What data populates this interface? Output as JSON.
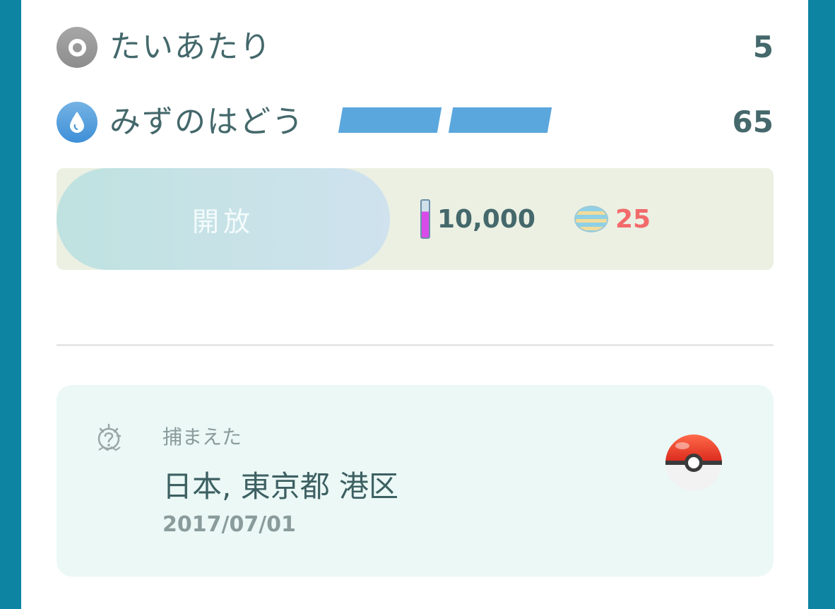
{
  "moves": [
    {
      "type_icon": "normal-type-icon",
      "name": "たいあたり",
      "power": "5"
    },
    {
      "type_icon": "water-type-icon",
      "name": "みずのはどう",
      "power": "65",
      "energy_bars": 2
    }
  ],
  "unlock": {
    "button_label": "開放",
    "stardust_icon": "stardust-icon",
    "stardust_cost": "10,000",
    "candy_icon": "candy-icon",
    "candy_cost": "25"
  },
  "capture": {
    "icon": "capture-info-icon",
    "label": "捕まえた",
    "location": "日本, 東京都 港区",
    "date": "2017/07/01",
    "ball_icon": "pokeball-icon"
  },
  "colors": {
    "background": "#0e84a3",
    "text": "#44686b",
    "water": "#5aa7dd",
    "candy_cost": "#f26a6a",
    "capture_card": "#ebf8f6"
  }
}
